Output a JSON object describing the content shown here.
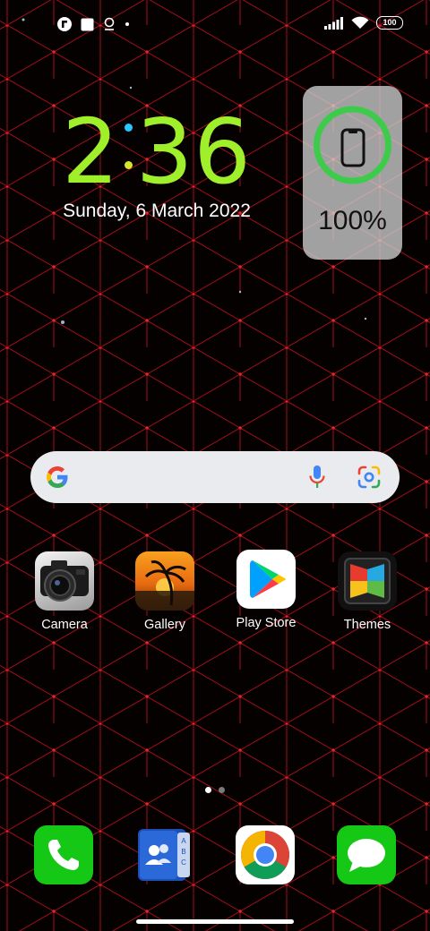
{
  "status_bar": {
    "left_icons": [
      "flipboard-icon",
      "square-notification-icon",
      "location-icon",
      "dot-icon"
    ],
    "right_icons": [
      "signal-icon",
      "wifi-icon"
    ],
    "battery_level": "100"
  },
  "clock_widget": {
    "hour": "2",
    "minutes": "36",
    "date": "Sunday, 6 March 2022"
  },
  "battery_widget": {
    "percent_text": "100%",
    "level": 1.0,
    "ring_color": "#3ecb4b"
  },
  "search_bar": {
    "icons": [
      "google-g-icon",
      "microphone-icon",
      "google-lens-icon"
    ]
  },
  "apps": [
    {
      "label": "Camera"
    },
    {
      "label": "Gallery"
    },
    {
      "label": "Play Store"
    },
    {
      "label": "Themes"
    }
  ],
  "page_indicator": {
    "count": 2,
    "active": 1
  },
  "dock": [
    "phone-icon",
    "contacts-icon",
    "chrome-icon",
    "messages-icon"
  ],
  "colors": {
    "wallpaper_lines": "#b0101a",
    "clock_green": "#9fef2a",
    "phone_green": "#16c816"
  }
}
